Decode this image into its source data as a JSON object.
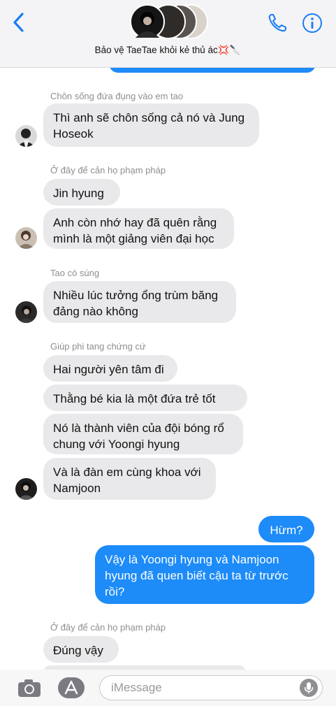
{
  "header": {
    "title": "Bảo vệ TaeTae khỏi kẻ thủ ác💢🔪",
    "icons": [
      "back-chevron-icon",
      "phone-icon",
      "info-icon"
    ],
    "accent_color": "#1a7cf5"
  },
  "messages": [
    {
      "sender": "Chôn sống đứa đụng vào em tao",
      "text1": "Thì anh sẽ chôn sống cả nó và Jung",
      "text2": "Hoseok"
    },
    {
      "sender": "Ở đây để cản họ phạm pháp",
      "text_a": "Jin hyung",
      "text_b1": "Anh còn nhớ hay đã quên rằng",
      "text_b2": "mình là một giảng viên đại học"
    },
    {
      "sender": "Tao có súng",
      "text1": "Nhiều lúc tưởng ổng trùm băng",
      "text2": "đảng nào không"
    },
    {
      "sender": "Giúp phi tang chứng cứ",
      "text_a": "Hai người yên tâm đi",
      "text_b": "Thằng bé kia là một đứa trẻ tốt",
      "text_c1": "Nó là thành viên của đội bóng rổ",
      "text_c2": "chung với Yoongi hyung",
      "text_d1": "Và là đàn em cùng khoa với",
      "text_d2": "Namjoon"
    },
    {
      "out_a": "Hừm?",
      "out_b1": "Vậy là Yoongi hyung và Namjoon",
      "out_b2": "hyung đã quen biết cậu ta từ trước",
      "out_b3": "rồi?"
    },
    {
      "sender": "Ở đây để cản họ phạm pháp",
      "text_a": "Đúng vậy"
    }
  ],
  "composer": {
    "placeholder": "iMessage",
    "icons": [
      "camera-icon",
      "app-store-icon",
      "microphone-icon"
    ]
  },
  "colors": {
    "incoming_bubble": "#e9e9eb",
    "outgoing_bubble": "#1d8bf8",
    "sender_label": "#8e8e93"
  }
}
